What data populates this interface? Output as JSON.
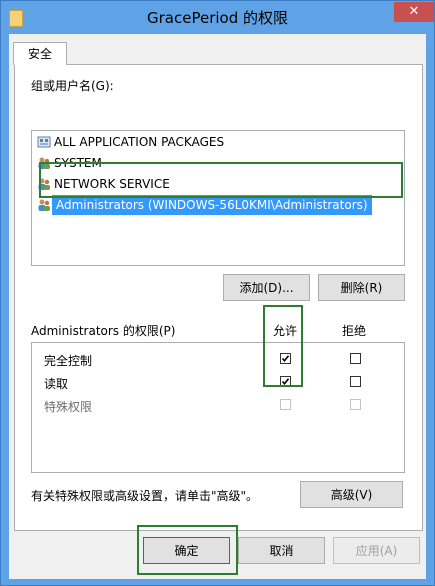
{
  "window": {
    "title": "GracePeriod 的权限",
    "close_glyph": "✕"
  },
  "tabs": [
    {
      "label": "安全"
    }
  ],
  "groups": {
    "label": "组或用户名(G):",
    "items": [
      {
        "name": "ALL APPLICATION PACKAGES",
        "icon": "packages-icon",
        "selected": false
      },
      {
        "name": "SYSTEM",
        "icon": "users-icon",
        "selected": false
      },
      {
        "name": "NETWORK SERVICE",
        "icon": "users-icon",
        "selected": false
      },
      {
        "name": "Administrators (WINDOWS-56L0KMI\\Administrators)",
        "icon": "users-icon",
        "selected": true
      }
    ],
    "add_button": "添加(D)...",
    "remove_button": "删除(R)"
  },
  "permissions": {
    "label": "Administrators 的权限(P)",
    "allow_header": "允许",
    "deny_header": "拒绝",
    "rows": [
      {
        "name": "完全控制",
        "allow": true,
        "deny": false,
        "disabled": false
      },
      {
        "name": "读取",
        "allow": true,
        "deny": false,
        "disabled": false
      },
      {
        "name": "特殊权限",
        "allow": false,
        "deny": false,
        "disabled": true
      }
    ]
  },
  "advanced": {
    "note": "有关特殊权限或高级设置，请单击\"高级\"。",
    "button": "高级(V)"
  },
  "footer": {
    "ok": "确定",
    "cancel": "取消",
    "apply": "应用(A)"
  },
  "colors": {
    "titlebar": "#5fa2e6",
    "selection": "#3399ff",
    "highlight_outline": "#2e7d32",
    "close_button": "#c75050"
  }
}
